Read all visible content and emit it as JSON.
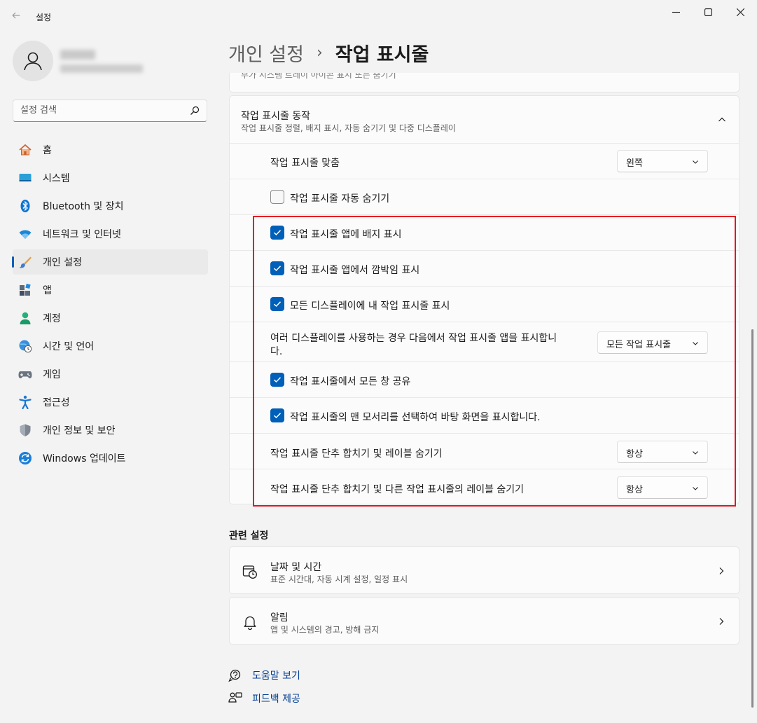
{
  "window": {
    "title": "설정"
  },
  "search": {
    "placeholder": "설정 검색"
  },
  "nav": {
    "items": [
      {
        "label": "홈"
      },
      {
        "label": "시스템"
      },
      {
        "label": "Bluetooth 및 장치"
      },
      {
        "label": "네트워크 및 인터넷"
      },
      {
        "label": "개인 설정"
      },
      {
        "label": "앱"
      },
      {
        "label": "계정"
      },
      {
        "label": "시간 및 언어"
      },
      {
        "label": "게임"
      },
      {
        "label": "접근성"
      },
      {
        "label": "개인 정보 및 보안"
      },
      {
        "label": "Windows 업데이트"
      }
    ]
  },
  "header": {
    "parent": "개인 설정",
    "separator": "›",
    "current": "작업 표시줄"
  },
  "cut_card": {
    "text": "부가 시스템 트레이 아이콘 표시 또는 숨기기"
  },
  "behaviors": {
    "title": "작업 표시줄 동작",
    "subtitle": "작업 표시줄 정렬, 배지 표시, 자동 숨기기 및 다중 디스플레이",
    "alignment": {
      "label": "작업 표시줄 맞춤",
      "value": "왼쪽"
    },
    "auto_hide": {
      "label": "작업 표시줄 자동 숨기기",
      "checked": false
    },
    "badges": {
      "label": "작업 표시줄 앱에 배지 표시",
      "checked": true
    },
    "flashing": {
      "label": "작업 표시줄 앱에서 깜박임 표시",
      "checked": true
    },
    "all_displays": {
      "label": "모든 디스플레이에 내 작업 표시줄 표시",
      "checked": true
    },
    "multi_display": {
      "label_line1": "여러 디스플레이를 사용하는 경우 다음에서 작업 표시줄 앱을 표시합니",
      "label_line2": "다.",
      "value": "모든 작업 표시줄"
    },
    "share_window": {
      "label": "작업 표시줄에서 모든 창 공유",
      "checked": true
    },
    "far_corner": {
      "label": "작업 표시줄의 맨 모서리를 선택하여 바탕 화면을 표시합니다.",
      "checked": true
    },
    "combine": {
      "label": "작업 표시줄 단추 합치기 및 레이블 숨기기",
      "value": "항상"
    },
    "combine_other": {
      "label": "작업 표시줄 단추 합치기 및 다른 작업 표시줄의 레이블 숨기기",
      "value": "항상"
    }
  },
  "related": {
    "title": "관련 설정",
    "cards": [
      {
        "title": "날짜 및 시간",
        "subtitle": "표준 시간대, 자동 시계 설정, 일정 표시",
        "icon": "calendar-clock-icon"
      },
      {
        "title": "알림",
        "subtitle": "앱 및 시스템의 경고, 방해 금지",
        "icon": "bell-icon"
      }
    ]
  },
  "help": {
    "get_help": "도움말 보기",
    "feedback": "피드백 제공"
  },
  "colors": {
    "accent": "#005fb8",
    "highlight": "#e81123",
    "background": "#f3f3f3",
    "card": "#fbfbfb"
  }
}
